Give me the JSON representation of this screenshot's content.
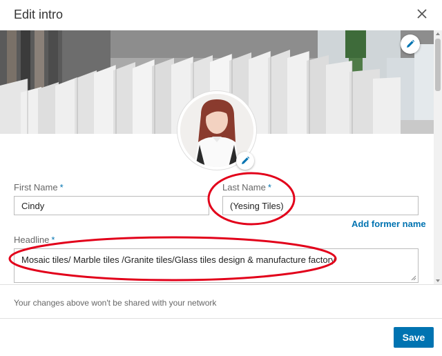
{
  "dialog": {
    "title": "Edit intro",
    "close_icon": "close-icon"
  },
  "banner": {
    "image": "tile-showroom-photo",
    "edit_icon": "pencil-icon"
  },
  "profile_photo": {
    "image": "profile-photo",
    "edit_icon": "pencil-icon"
  },
  "form": {
    "first_name": {
      "label": "First Name",
      "required_mark": "*",
      "value": "Cindy"
    },
    "last_name": {
      "label": "Last Name",
      "required_mark": "*",
      "value": "(Yesing Tiles)"
    },
    "add_former_name": "Add former name",
    "headline": {
      "label": "Headline",
      "required_mark": "*",
      "value": "Mosaic tiles/ Marble tiles /Granite tiles/Glass tiles design & manufacture factory"
    }
  },
  "footer": {
    "note": "Your changes above won't be shared with your network",
    "save_label": "Save"
  },
  "colors": {
    "accent": "#0073b1",
    "annotation": "#e2001a"
  }
}
